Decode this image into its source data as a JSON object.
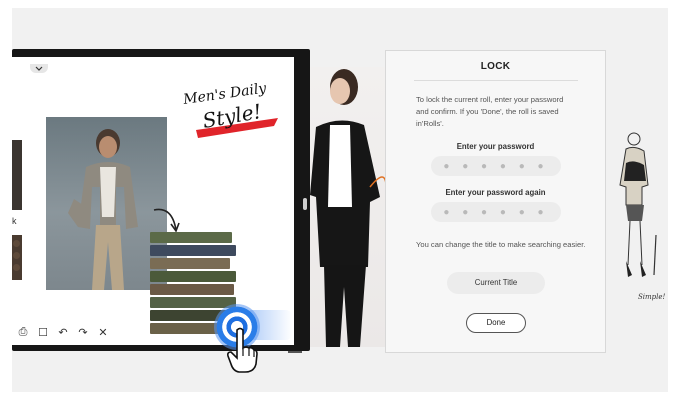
{
  "whiteboard": {
    "handwriting_line1": "Men's Daily",
    "handwriting_line2": "Style!",
    "side_letter": "k",
    "toolbar": {
      "icons": [
        "save-icon",
        "select-icon",
        "undo-icon",
        "redo-icon",
        "close-icon"
      ],
      "glyphs": [
        "⎙",
        "☐",
        "↶",
        "↷",
        "✕"
      ]
    }
  },
  "lock_dialog": {
    "title": "LOCK",
    "description": "To lock the current roll, enter your password and confirm. If you 'Done', the roll is saved in'Rolls'.",
    "password_label": "Enter your password",
    "password_mask": "● ● ● ● ● ●",
    "confirm_label": "Enter your password again",
    "confirm_mask": "● ● ● ● ● ●",
    "note": "You can change the title to make searching easier.",
    "title_button": "Current Title",
    "done_button": "Done"
  },
  "sketch": {
    "caption": "Simple!"
  },
  "colors": {
    "accent_blue": "#2a7de8",
    "handwriting_red": "#e0242a",
    "panel_bg": "#f7f7f7"
  }
}
